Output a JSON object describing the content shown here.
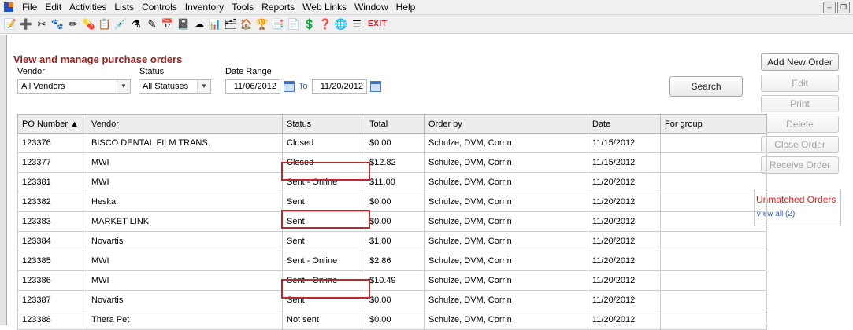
{
  "menu": [
    "File",
    "Edit",
    "Activities",
    "Lists",
    "Controls",
    "Inventory",
    "Tools",
    "Reports",
    "Web Links",
    "Window",
    "Help"
  ],
  "toolbar": {
    "icons": [
      "📝",
      "➕",
      "✂",
      "🐾",
      "✏",
      "💊",
      "📋",
      "💉",
      "⚗",
      "✎",
      "📅",
      "📓",
      "☁",
      "📊",
      "🗂",
      "🏠",
      "🏆",
      "📑",
      "📄",
      "💲",
      "❓",
      "🌐",
      "☰"
    ],
    "exit_label": "EXIT"
  },
  "page": {
    "title": "View and manage purchase orders"
  },
  "filters": {
    "vendor_label": "Vendor",
    "vendor_value": "All Vendors",
    "status_label": "Status",
    "status_value": "All Statuses",
    "date_range_label": "Date Range",
    "date_from": "11/06/2012",
    "to_label": "To",
    "date_to": "11/20/2012",
    "search_label": "Search"
  },
  "actions": {
    "add_new_order": "Add New Order",
    "edit": "Edit",
    "print": "Print",
    "delete": "Delete",
    "close_order": "Close Order",
    "receive_order": "Receive Order"
  },
  "table": {
    "columns": [
      "PO Number ▲",
      "Vendor",
      "Status",
      "Total",
      "Order by",
      "Date",
      "For group"
    ],
    "rows": [
      [
        "123376",
        "BISCO DENTAL FILM TRANS.",
        "Closed",
        "$0.00",
        "Schulze, DVM, Corrin",
        "11/15/2012",
        ""
      ],
      [
        "123377",
        "MWI",
        "Closed",
        "$12.82",
        "Schulze, DVM, Corrin",
        "11/15/2012",
        ""
      ],
      [
        "123381",
        "MWI",
        "Sent - Online",
        "$11.00",
        "Schulze, DVM, Corrin",
        "11/20/2012",
        ""
      ],
      [
        "123382",
        "Heska",
        "Sent",
        "$0.00",
        "Schulze, DVM, Corrin",
        "11/20/2012",
        ""
      ],
      [
        "123383",
        "MARKET LINK",
        "Sent",
        "$0.00",
        "Schulze, DVM, Corrin",
        "11/20/2012",
        ""
      ],
      [
        "123384",
        "Novartis",
        "Sent",
        "$1.00",
        "Schulze, DVM, Corrin",
        "11/20/2012",
        ""
      ],
      [
        "123385",
        "MWI",
        "Sent - Online",
        "$2.86",
        "Schulze, DVM, Corrin",
        "11/20/2012",
        ""
      ],
      [
        "123386",
        "MWI",
        "Sent - Online",
        "$10.49",
        "Schulze, DVM, Corrin",
        "11/20/2012",
        ""
      ],
      [
        "123387",
        "Novartis",
        "Sent",
        "$0.00",
        "Schulze, DVM, Corrin",
        "11/20/2012",
        ""
      ],
      [
        "123388",
        "Thera Pet",
        "Not sent",
        "$0.00",
        "Schulze, DVM, Corrin",
        "11/20/2012",
        ""
      ]
    ]
  },
  "unmatched": {
    "title": "Unmatched Orders",
    "link": "View all (2)"
  },
  "colors": {
    "title": "#9a1f1f",
    "highlight": "#c0262b",
    "unmatched": "#e0201c",
    "link": "#2a5fc4"
  }
}
